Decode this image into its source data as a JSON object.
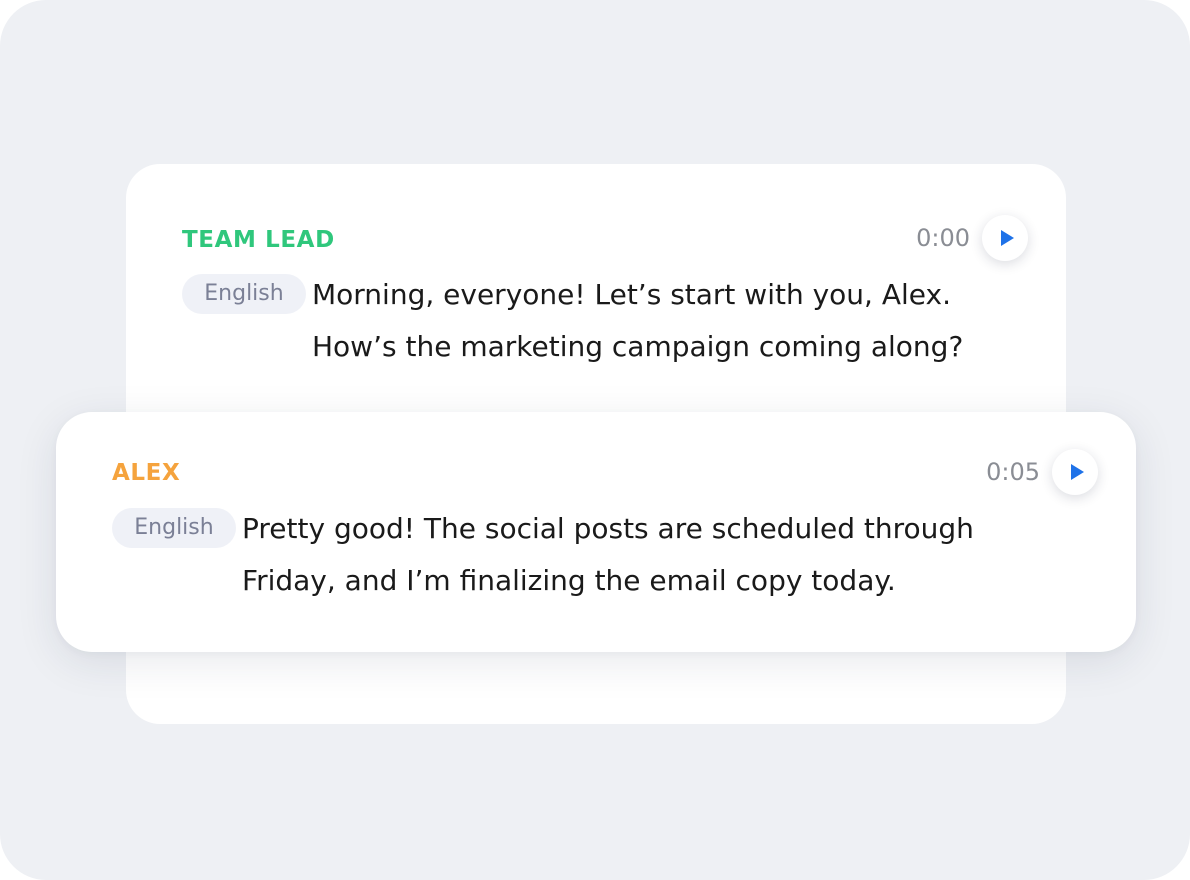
{
  "colors": {
    "background": "#eef0f4",
    "card": "#ffffff",
    "team_lead_accent": "#2fc77c",
    "alex_accent": "#f5a33d",
    "play_icon": "#1f72e8"
  },
  "messages": [
    {
      "speaker": "TEAM LEAD",
      "timestamp": "0:00",
      "language": "English",
      "line1": "Morning, everyone! Let’s start with you, Alex.",
      "line2": "How’s the marketing campaign coming along?",
      "play_icon": "play-icon"
    },
    {
      "speaker": "ALEX",
      "timestamp": "0:05",
      "language": "English",
      "line1": "Pretty good! The social posts are scheduled through",
      "line2": "Friday, and I’m finalizing the email copy today.",
      "play_icon": "play-icon"
    }
  ]
}
